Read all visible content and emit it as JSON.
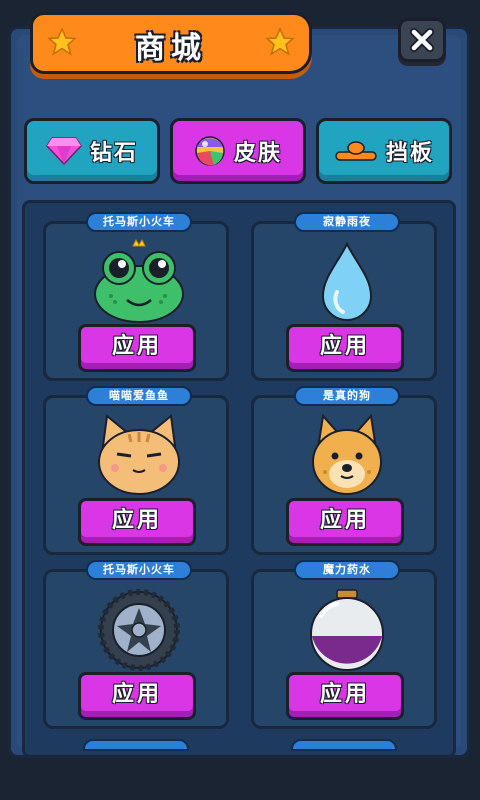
{
  "header": {
    "title": "商城",
    "close_icon": "close-icon"
  },
  "tabs": [
    {
      "label": "钻石",
      "icon": "diamond-icon",
      "active": false
    },
    {
      "label": "皮肤",
      "icon": "rainbow-ball-icon",
      "active": true
    },
    {
      "label": "挡板",
      "icon": "paddle-icon",
      "active": false
    }
  ],
  "skins": [
    {
      "name": "托马斯小火车",
      "art": "frog-icon",
      "button": "应用"
    },
    {
      "name": "寂静雨夜",
      "art": "water-drop-icon",
      "button": "应用"
    },
    {
      "name": "喵喵爱鱼鱼",
      "art": "cat-icon",
      "button": "应用"
    },
    {
      "name": "是真的狗",
      "art": "dog-icon",
      "button": "应用"
    },
    {
      "name": "托马斯小火车",
      "art": "wheel-icon",
      "button": "应用"
    },
    {
      "name": "魔力药水",
      "art": "potion-icon",
      "button": "应用"
    }
  ],
  "colors": {
    "accent_orange": "#ff8a1c",
    "tab_cyan": "#21a4c0",
    "button_magenta": "#d936e6",
    "panel_blue": "#294a77"
  }
}
